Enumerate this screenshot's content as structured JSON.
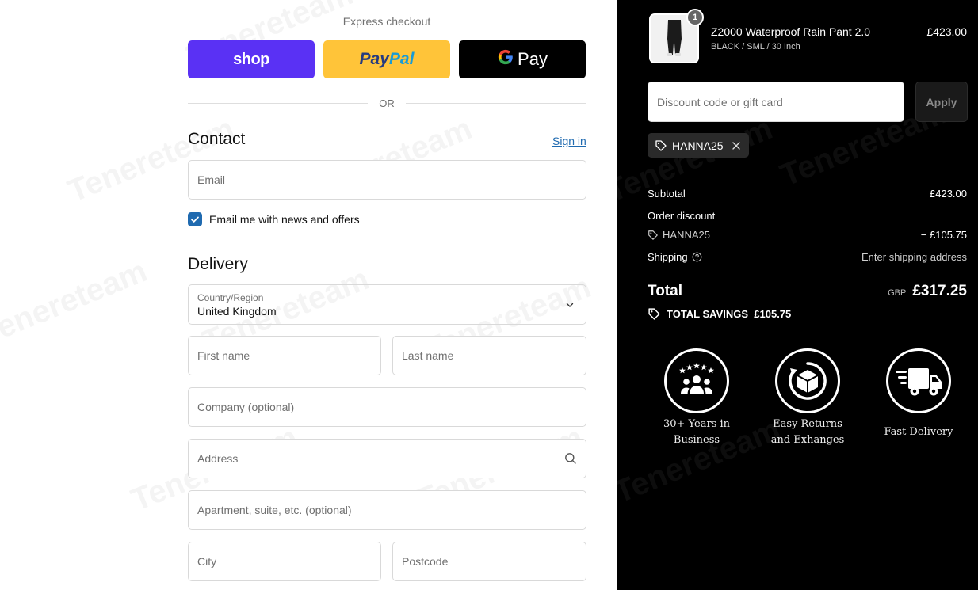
{
  "express": {
    "title": "Express checkout",
    "shop_label": "shop",
    "paypal_label_1": "Pay",
    "paypal_label_2": "Pal",
    "gpay_label": "Pay",
    "or_label": "OR"
  },
  "contact": {
    "heading": "Contact",
    "signin_label": "Sign in",
    "email_placeholder": "Email",
    "news_checkbox_label": "Email me with news and offers",
    "news_checked": true
  },
  "delivery": {
    "heading": "Delivery",
    "country_label": "Country/Region",
    "country_value": "United Kingdom",
    "first_name_placeholder": "First name",
    "last_name_placeholder": "Last name",
    "company_placeholder": "Company (optional)",
    "address_placeholder": "Address",
    "apartment_placeholder": "Apartment, suite, etc. (optional)",
    "city_placeholder": "City",
    "postcode_placeholder": "Postcode"
  },
  "cart": {
    "item": {
      "quantity": "1",
      "name": "Z2000 Waterproof Rain Pant 2.0",
      "variant": "BLACK / SML / 30 Inch",
      "price": "£423.00"
    },
    "discount_placeholder": "Discount code or gift card",
    "apply_label": "Apply",
    "applied_code": "HANNA25"
  },
  "summary": {
    "subtotal_label": "Subtotal",
    "subtotal_value": "£423.00",
    "order_discount_label": "Order discount",
    "discount_code": "HANNA25",
    "discount_value": "− £105.75",
    "shipping_label": "Shipping",
    "shipping_value": "Enter shipping address",
    "total_label": "Total",
    "total_currency": "GBP",
    "total_value": "£317.25",
    "savings_label": "TOTAL SAVINGS  £105.75"
  },
  "badges": [
    {
      "line1": "30+ Years in",
      "line2": "Business",
      "icon": "people-stars-icon"
    },
    {
      "line1": "Easy Returns",
      "line2": "and Exhanges",
      "icon": "box-return-icon"
    },
    {
      "line1": "Fast Delivery",
      "line2": "",
      "icon": "delivery-truck-icon"
    }
  ],
  "watermark": "Tenereteam",
  "colors": {
    "shop_purple": "#5a31f4",
    "paypal_yellow": "#ffc439",
    "link_blue": "#1f6ab0",
    "summary_bg": "#000000"
  }
}
